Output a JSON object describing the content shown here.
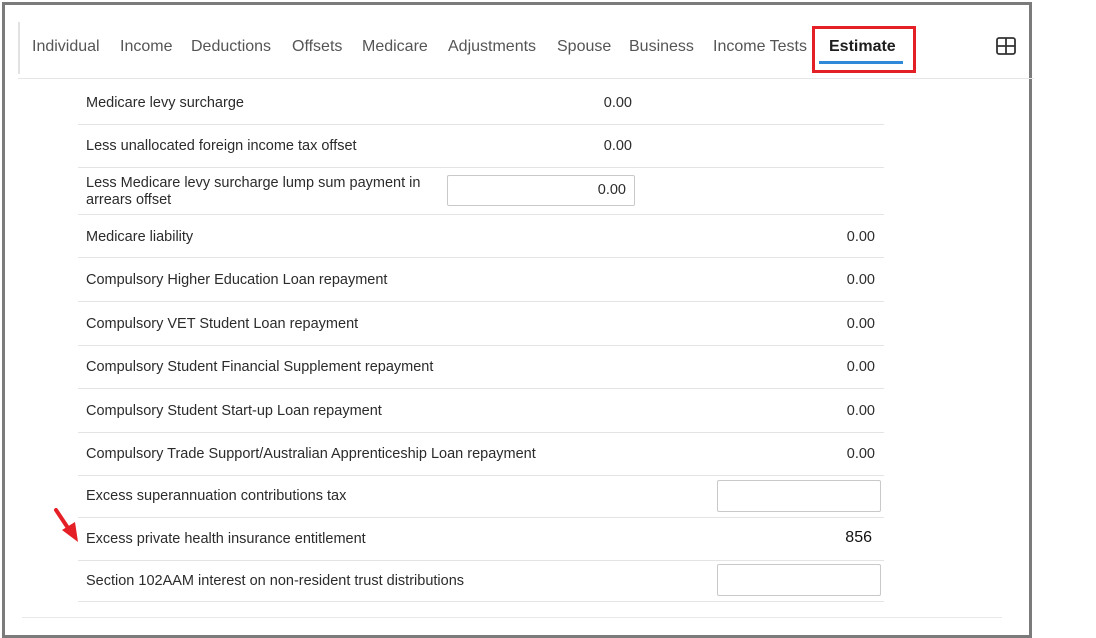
{
  "tabs": [
    {
      "label": "Individual"
    },
    {
      "label": "Income"
    },
    {
      "label": "Deductions"
    },
    {
      "label": "Offsets"
    },
    {
      "label": "Medicare"
    },
    {
      "label": "Adjustments"
    },
    {
      "label": "Spouse"
    },
    {
      "label": "Business"
    },
    {
      "label": "Income Tests"
    },
    {
      "label": "Estimate",
      "active": true
    }
  ],
  "icons": {
    "layout_toggle": "grid-layout-icon",
    "annotation_arrow": "red-arrow-icon"
  },
  "colors": {
    "accent_underline": "#2f88d8",
    "highlight_box": "#e41f26",
    "arrow": "#e41f26"
  },
  "rows": [
    {
      "label": "Medicare levy surcharge",
      "value": "0.00"
    },
    {
      "label": "Less unallocated foreign income tax offset",
      "value": "0.00"
    },
    {
      "label": "Less Medicare levy surcharge lump sum payment in arrears offset",
      "input_value": "0.00"
    },
    {
      "label": "Medicare liability",
      "value": "0.00"
    },
    {
      "label": "Compulsory Higher Education Loan repayment",
      "value": "0.00"
    },
    {
      "label": "Compulsory VET Student Loan repayment",
      "value": "0.00"
    },
    {
      "label": "Compulsory Student Financial Supplement repayment",
      "value": "0.00"
    },
    {
      "label": "Compulsory Student Start-up Loan repayment",
      "value": "0.00"
    },
    {
      "label": "Compulsory Trade Support/Australian Apprenticeship Loan repayment",
      "value": "0.00"
    },
    {
      "label": "Excess superannuation contributions tax",
      "input_value": ""
    },
    {
      "label": "Excess private health insurance entitlement",
      "value": "856"
    },
    {
      "label": "Section 102AAM interest on non-resident trust distributions",
      "input_value": ""
    }
  ]
}
